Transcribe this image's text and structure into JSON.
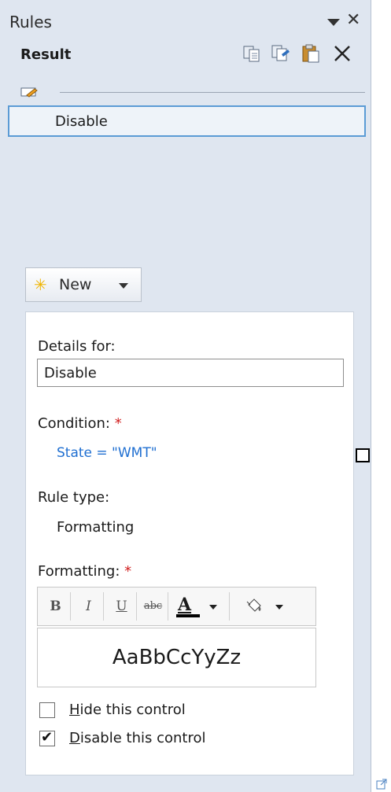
{
  "pane": {
    "title": "Rules"
  },
  "toolbar": {
    "label": "Result"
  },
  "rules_list": [
    {
      "label": "Disable"
    }
  ],
  "new_button": {
    "label": "New"
  },
  "details": {
    "details_for_label": "Details for:",
    "rule_name_value": "Disable",
    "condition_label": "Condition:",
    "required_mark": "*",
    "condition_value": "State = \"WMT\"",
    "rule_type_label": "Rule type:",
    "rule_type_value": "Formatting",
    "formatting_label": "Formatting:",
    "format_buttons": {
      "bold": "B",
      "italic": "I",
      "underline": "U",
      "strikethrough": "abc",
      "font_color": "A"
    },
    "preview_text": "AaBbCcYyZz",
    "hide_control": {
      "prefix": "",
      "accelerator": "H",
      "rest": "ide this control",
      "checked": false
    },
    "disable_control": {
      "prefix": "",
      "accelerator": "D",
      "rest": "isable this control",
      "checked": true
    }
  },
  "colors": {
    "accent": "#5b9bd5",
    "link": "#1f6fd1",
    "required": "#d11f1f",
    "pane_bg": "#dfe6f0"
  }
}
